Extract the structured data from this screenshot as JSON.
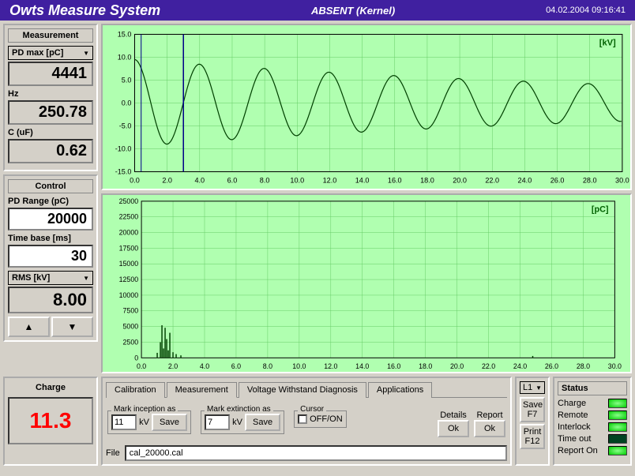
{
  "header": {
    "title": "Owts Measure System",
    "subtitle": "ABSENT (Kernel)",
    "timestamp": "04.02.2004 09:16:41"
  },
  "measurement": {
    "panel_title": "Measurement",
    "pd_max_label": "PD max [pC]",
    "pd_max_value": "4441",
    "hz_label": "Hz",
    "hz_value": "250.78",
    "c_label": "C (uF)",
    "c_value": "0.62"
  },
  "control": {
    "panel_title": "Control",
    "pd_range_label": "PD Range (pC)",
    "pd_range_value": "20000",
    "time_base_label": "Time base  [ms]",
    "time_base_value": "30",
    "rms_label": "RMS [kV]",
    "rms_value": "8.00"
  },
  "charge": {
    "panel_title": "Charge",
    "value": "11.3"
  },
  "tabs": {
    "calibration": "Calibration",
    "measurement": "Measurement",
    "voltage": "Voltage Withstand Diagnosis",
    "applications": "Applications"
  },
  "tab_content": {
    "mark_inception": "Mark inception as",
    "inception_val": "11",
    "kv": "kV",
    "save": "Save",
    "mark_extinction": "Mark extinction as",
    "extinction_val": "7",
    "cursor": "Cursor",
    "off_on": "OFF/ON",
    "details": "Details",
    "report": "Report",
    "ok": "Ok",
    "file_label": "File",
    "file_value": "cal_20000.cal"
  },
  "side": {
    "l1": "L1",
    "save": "Save",
    "f7": "F7",
    "print": "Print",
    "f12": "F12"
  },
  "status": {
    "title": "Status",
    "items": [
      {
        "label": "Charge",
        "on": true
      },
      {
        "label": "Remote",
        "on": true
      },
      {
        "label": "Interlock",
        "on": true
      },
      {
        "label": "Time out",
        "on": false
      },
      {
        "label": "Report On",
        "on": true
      }
    ]
  },
  "chart_data": [
    {
      "type": "line",
      "unit": "[kV]",
      "xlim": [
        0,
        30
      ],
      "ylim": [
        -15,
        15
      ],
      "xticks": [
        0,
        2,
        4,
        6,
        8,
        10,
        12,
        14,
        16,
        18,
        20,
        22,
        24,
        26,
        28,
        30
      ],
      "yticks": [
        -15,
        -10,
        -5,
        0,
        5,
        10,
        15
      ],
      "cursor_x": 3.0,
      "series": [
        {
          "name": "voltage",
          "color": "#004000",
          "frequency_hz": 250.78,
          "amplitude_initial": 9.5,
          "amplitude_final": 4.0,
          "zero_crossing_ms": 3.0,
          "description": "damped sinusoid starting at ~9.5kV decaying to ~4kV over 30ms"
        }
      ]
    },
    {
      "type": "bar",
      "unit": "[pC]",
      "xlim": [
        0,
        30
      ],
      "ylim": [
        0,
        25000
      ],
      "xticks": [
        0,
        2,
        4,
        6,
        8,
        10,
        12,
        14,
        16,
        18,
        20,
        22,
        24,
        26,
        28,
        30
      ],
      "yticks": [
        0,
        2500,
        5000,
        7500,
        10000,
        12500,
        15000,
        17500,
        20000,
        22500,
        25000
      ],
      "series": [
        {
          "name": "pd",
          "color": "#004000",
          "description": "PD burst cluster around 1-2ms peaking near 5000pC, minor spikes ~25ms",
          "data": [
            [
              1.0,
              800
            ],
            [
              1.2,
              2500
            ],
            [
              1.3,
              5200
            ],
            [
              1.4,
              1500
            ],
            [
              1.5,
              4800
            ],
            [
              1.6,
              3000
            ],
            [
              1.7,
              1200
            ],
            [
              1.8,
              4000
            ],
            [
              2.0,
              900
            ],
            [
              2.2,
              600
            ],
            [
              2.5,
              400
            ],
            [
              24.8,
              300
            ]
          ]
        }
      ]
    }
  ]
}
